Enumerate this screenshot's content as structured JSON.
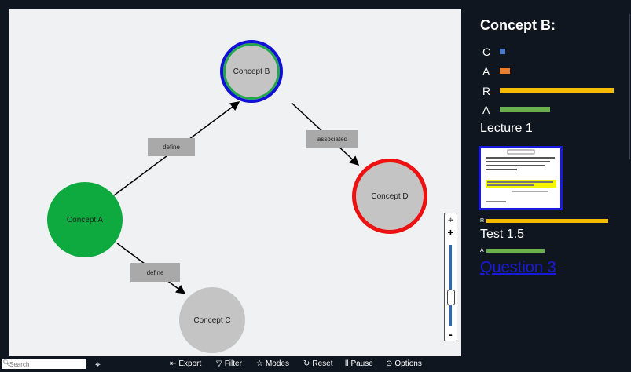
{
  "graph": {
    "nodes": [
      {
        "id": "b",
        "label": "Concept B"
      },
      {
        "id": "a",
        "label": "Concept A"
      },
      {
        "id": "c",
        "label": "Concept C"
      },
      {
        "id": "d",
        "label": "Concept D"
      }
    ],
    "edges": [
      {
        "from": "a",
        "to": "b",
        "label": "define"
      },
      {
        "from": "b",
        "to": "d",
        "label": "associated"
      },
      {
        "from": "a",
        "to": "c",
        "label": "define"
      }
    ],
    "colors": {
      "concept_a_fill": "#0faa3f",
      "concept_default_fill": "#c4c4c4",
      "concept_b_outer_ring": "#1010d8",
      "concept_b_inner_ring": "#22a84a",
      "concept_d_ring": "#ee1111",
      "edge_label_bg": "#a9a9a9"
    }
  },
  "zoom": {
    "plus": "+",
    "minus": "-"
  },
  "toolbar": {
    "search_placeholder": "Search",
    "export": "Export",
    "filter": "Filter",
    "modes": "Modes",
    "reset": "Reset",
    "pause": "Pause",
    "options": "Options"
  },
  "panel": {
    "title": "Concept B:",
    "metrics": [
      {
        "label": "C",
        "level": 0.05,
        "color": "#4a78c8"
      },
      {
        "label": "A",
        "level": 0.09,
        "color": "#ee7d2a"
      },
      {
        "label": "R",
        "level": 1.0,
        "color": "#f5bb00"
      },
      {
        "label": "A",
        "level": 0.44,
        "color": "#6ab04c"
      }
    ],
    "lecture": "Lecture 1",
    "lecture_metric": {
      "label": "R",
      "level": 1.0,
      "color": "#f5bb00"
    },
    "test": "Test 1.5",
    "test_metric": {
      "label": "A",
      "level": 0.48,
      "color": "#6ab04c"
    },
    "question_link": "Question 3"
  }
}
